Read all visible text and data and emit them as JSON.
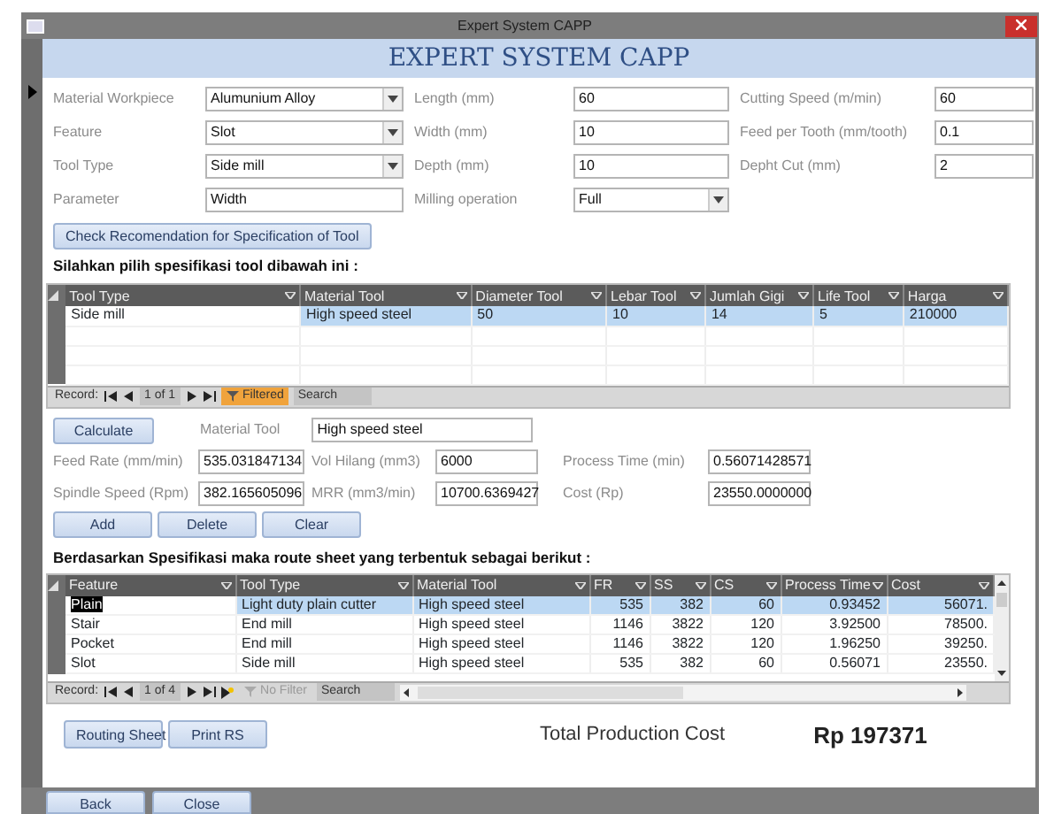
{
  "window": {
    "title": "Expert System CAPP"
  },
  "header": "EXPERT SYSTEM CAPP",
  "form": {
    "columns": [
      {
        "fields": [
          {
            "label": "Material Workpiece",
            "value": "Alumunium Alloy",
            "kind": "select"
          },
          {
            "label": "Feature",
            "value": "Slot",
            "kind": "select"
          },
          {
            "label": "Tool Type",
            "value": "Side mill",
            "kind": "select"
          },
          {
            "label": "Parameter",
            "value": "Width",
            "kind": "text"
          }
        ]
      },
      {
        "fields": [
          {
            "label": "Length (mm)",
            "value": "60",
            "kind": "text"
          },
          {
            "label": "Width (mm)",
            "value": "10",
            "kind": "text"
          },
          {
            "label": "Depth (mm)",
            "value": "10",
            "kind": "text"
          },
          {
            "label": "Milling operation",
            "value": "Full",
            "kind": "select"
          }
        ]
      },
      {
        "fields": [
          {
            "label": "Cutting Speed (m/min)",
            "value": "60",
            "kind": "text"
          },
          {
            "label": "Feed per Tooth (mm/tooth)",
            "value": "0.1",
            "kind": "text"
          },
          {
            "label": "Depht Cut (mm)",
            "value": "2",
            "kind": "text"
          }
        ]
      }
    ]
  },
  "check_button": "Check Recomendation for Specification of Tool",
  "tool_instruction": "Silahkan pilih spesifikasi tool dibawah ini :",
  "tool_table": {
    "columns": [
      {
        "label": "Tool Type"
      },
      {
        "label": "Material Tool"
      },
      {
        "label": "Diameter Tool"
      },
      {
        "label": "Lebar Tool"
      },
      {
        "label": "Jumlah Gigi"
      },
      {
        "label": "Life Tool"
      },
      {
        "label": "Harga"
      }
    ],
    "rows": [
      {
        "cells": [
          "Side mill",
          "High speed steel",
          "50",
          "10",
          "14",
          "5",
          "210000"
        ],
        "selected": true
      }
    ],
    "navigator": {
      "label": "Record:",
      "position": "1 of 1",
      "filter": "Filtered",
      "filtered": true,
      "search": "Search"
    }
  },
  "calc": {
    "button": "Calculate",
    "material_tool": {
      "label": "Material Tool",
      "value": "High speed steel"
    },
    "fields": [
      {
        "label": "Feed Rate (mm/min)",
        "value": "535.031847134"
      },
      {
        "label": "Vol Hilang (mm3)",
        "value": "6000"
      },
      {
        "label": "Process Time (min)",
        "value": "0.56071428571"
      },
      {
        "label": "Spindle Speed (Rpm)",
        "value": "382.165605096"
      },
      {
        "label": "MRR (mm3/min)",
        "value": "10700.6369427"
      },
      {
        "label": "Cost (Rp)",
        "value": "23550.0000000"
      }
    ],
    "buttons": [
      "Add",
      "Delete",
      "Clear"
    ]
  },
  "route_instruction": "Berdasarkan Spesifikasi maka route sheet yang terbentuk sebagai berikut :",
  "route_table": {
    "columns": [
      {
        "label": "Feature"
      },
      {
        "label": "Tool Type"
      },
      {
        "label": "Material Tool"
      },
      {
        "label": "FR"
      },
      {
        "label": "SS"
      },
      {
        "label": "CS"
      },
      {
        "label": "Process Time"
      },
      {
        "label": "Cost"
      }
    ],
    "rows": [
      {
        "cells": [
          "Plain",
          "Light duty plain cutter",
          "High speed steel",
          "535",
          "382",
          "60",
          "0.93452",
          "56071."
        ],
        "selected": true
      },
      {
        "cells": [
          "Stair",
          "End mill",
          "High speed steel",
          "1146",
          "3822",
          "120",
          "3.92500",
          "78500."
        ],
        "selected": false
      },
      {
        "cells": [
          "Pocket",
          "End mill",
          "High speed steel",
          "1146",
          "3822",
          "120",
          "1.96250",
          "39250."
        ],
        "selected": false
      },
      {
        "cells": [
          "Slot",
          "Side mill",
          "High speed steel",
          "535",
          "382",
          "60",
          "0.56071",
          "23550."
        ],
        "selected": false
      }
    ],
    "navigator": {
      "label": "Record:",
      "position": "1 of 4",
      "filter": "No Filter",
      "filtered": false,
      "search": "Search"
    }
  },
  "route_buttons": [
    "Routing Sheet",
    "Print RS"
  ],
  "total": {
    "label": "Total Production Cost",
    "value": "Rp 197371"
  },
  "footer_buttons": [
    "Back",
    "Close"
  ]
}
